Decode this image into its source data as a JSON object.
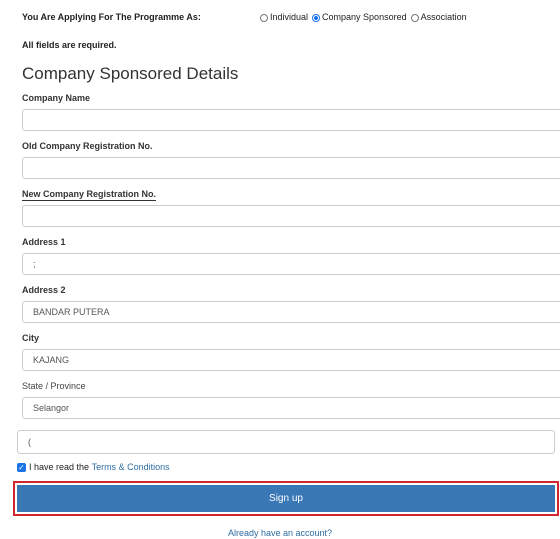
{
  "applying": {
    "label": "You Are Applying For The Programme As:",
    "options": [
      "Individual",
      "Company Sponsored",
      "Association"
    ],
    "selected": "Company Sponsored"
  },
  "required_note": "All fields are required.",
  "section_title": "Company Sponsored Details",
  "fields": {
    "company_name": {
      "label": "Company Name",
      "value": ""
    },
    "old_reg": {
      "label": "Old Company Registration No.",
      "value": ""
    },
    "new_reg": {
      "label": "New Company Registration No.",
      "value": ""
    },
    "address1": {
      "label": "Address 1",
      "value": ";"
    },
    "address2": {
      "label": "Address 2",
      "value": "BANDAR PUTERA"
    },
    "city": {
      "label": "City",
      "value": "KAJANG"
    },
    "state": {
      "label": "State / Province",
      "value": "Selangor"
    },
    "extra": {
      "value": "("
    }
  },
  "terms": {
    "prefix": "I have read the",
    "link": "Terms & Conditions"
  },
  "signup_button": "Sign up",
  "account_link": "Already have an account?",
  "colors": {
    "button_bg": "#3a78b5",
    "highlight_border": "#d0282e",
    "link": "#2d6da3"
  }
}
